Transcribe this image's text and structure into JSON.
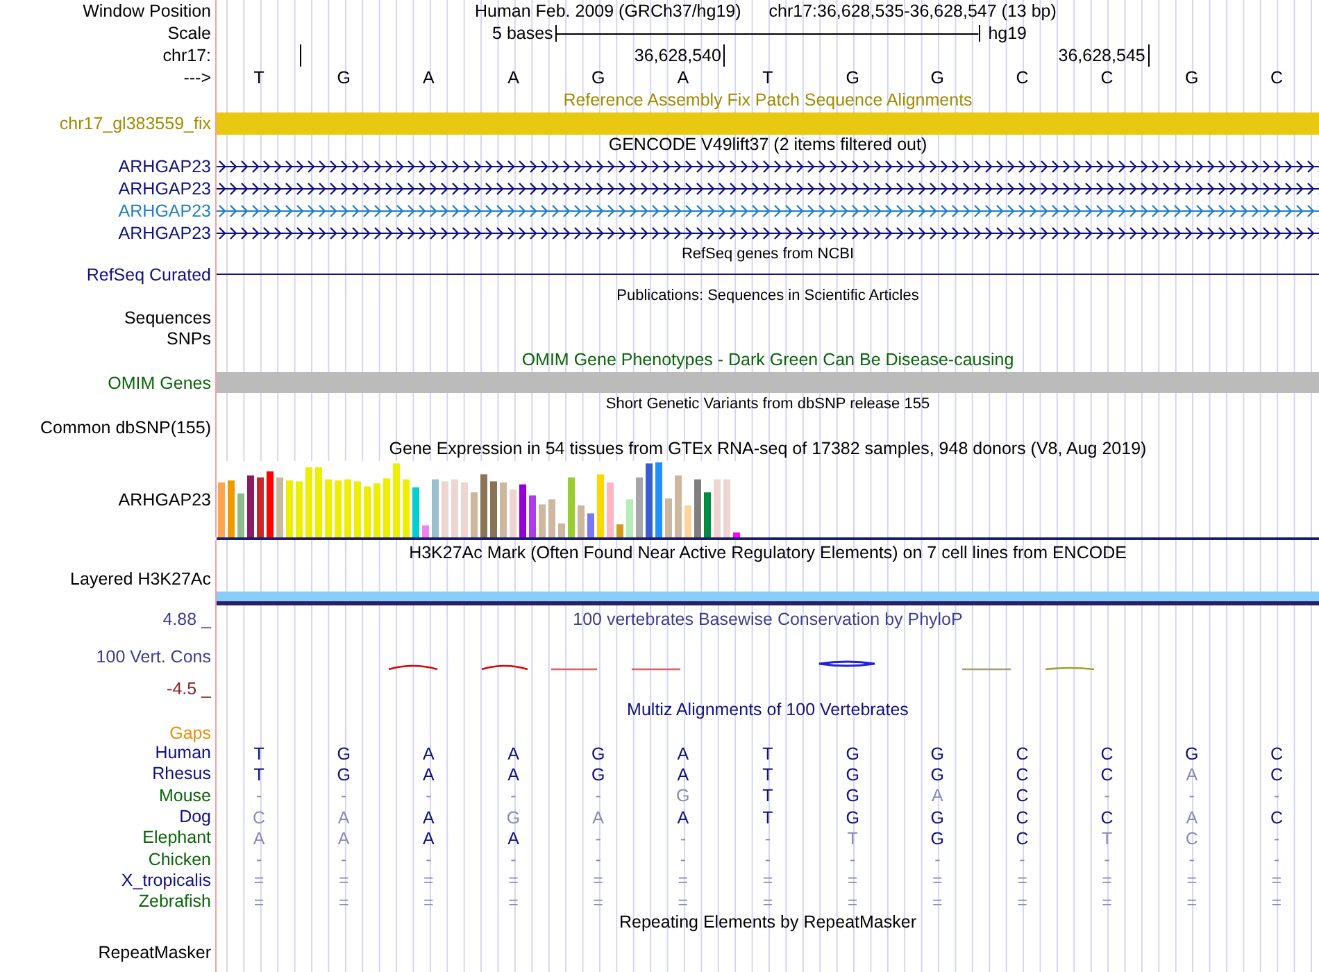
{
  "ruler": {
    "position_label": "Window Position",
    "assembly": "Human Feb. 2009 (GRCh37/hg19)",
    "range": "chr17:36,628,535-36,628,547 (13 bp)",
    "scale_label": "Scale",
    "scale_text": "5 bases",
    "scale_assembly": "hg19",
    "chrom_label": "chr17:",
    "ticks": [
      {
        "kind": "mark"
      },
      {
        "kind": "labeled",
        "label": "36,628,540"
      },
      {
        "kind": "labeled",
        "label": "36,628,545"
      }
    ],
    "strand_label": "--->",
    "bases": [
      "T",
      "G",
      "A",
      "A",
      "G",
      "A",
      "T",
      "G",
      "G",
      "C",
      "C",
      "G",
      "C"
    ]
  },
  "tracks": [
    {
      "kind": "fix_patch",
      "title": "Reference Assembly Fix Patch Sequence Alignments",
      "label": "chr17_gl383559_fix"
    },
    {
      "kind": "genes",
      "title": "GENCODE V49lift37 (2 items filtered out)",
      "genes": [
        {
          "label": "ARHGAP23",
          "color": "#10107e"
        },
        {
          "label": "ARHGAP23",
          "color": "#10107e"
        },
        {
          "label": "ARHGAP23",
          "color": "#1f7fc4"
        },
        {
          "label": "ARHGAP23",
          "color": "#10107e"
        }
      ]
    },
    {
      "kind": "refseq",
      "title": "RefSeq genes from NCBI",
      "label": "RefSeq Curated"
    },
    {
      "kind": "publications",
      "title": "Publications: Sequences in Scientific Articles",
      "labels": [
        "Sequences",
        "SNPs"
      ]
    },
    {
      "kind": "omim",
      "title": "OMIM Gene Phenotypes - Dark Green Can Be Disease-causing",
      "label": "OMIM Genes"
    },
    {
      "kind": "dbsnp",
      "title": "Short Genetic Variants from dbSNP release 155",
      "label": "Common dbSNP(155)"
    },
    {
      "kind": "gtex",
      "title": "Gene Expression in 54 tissues from GTEx RNA-seq of 17382 samples, 948 donors (V8, Aug 2019)",
      "label": "ARHGAP23"
    },
    {
      "kind": "h3k27ac",
      "title": "H3K27Ac Mark (Often Found Near Active Regulatory Elements) on 7 cell lines from ENCODE",
      "label": "Layered H3K27Ac"
    },
    {
      "kind": "phylop",
      "title": "100 vertebrates Basewise Conservation by PhyloP",
      "label": "100 Vert. Cons",
      "max_label": "4.88 _",
      "min_label": "-4.5 _"
    },
    {
      "kind": "multiz",
      "title": "Multiz Alignments of 100 Vertebrates",
      "gaps_label": "Gaps",
      "species": [
        {
          "name": "Human",
          "color": "#10107e",
          "bases": [
            {
              "base": "T",
              "dim": false
            },
            {
              "base": "G",
              "dim": false
            },
            {
              "base": "A",
              "dim": false
            },
            {
              "base": "A",
              "dim": false
            },
            {
              "base": "G",
              "dim": false
            },
            {
              "base": "A",
              "dim": false
            },
            {
              "base": "T",
              "dim": false
            },
            {
              "base": "G",
              "dim": false
            },
            {
              "base": "G",
              "dim": false
            },
            {
              "base": "C",
              "dim": false
            },
            {
              "base": "C",
              "dim": false
            },
            {
              "base": "G",
              "dim": false
            },
            {
              "base": "C",
              "dim": false
            }
          ]
        },
        {
          "name": "Rhesus",
          "color": "#10107e",
          "bases": [
            {
              "base": "T",
              "dim": false
            },
            {
              "base": "G",
              "dim": false
            },
            {
              "base": "A",
              "dim": false
            },
            {
              "base": "A",
              "dim": false
            },
            {
              "base": "G",
              "dim": false
            },
            {
              "base": "A",
              "dim": false
            },
            {
              "base": "T",
              "dim": false
            },
            {
              "base": "G",
              "dim": false
            },
            {
              "base": "G",
              "dim": false
            },
            {
              "base": "C",
              "dim": false
            },
            {
              "base": "C",
              "dim": false
            },
            {
              "base": "A",
              "dim": true
            },
            {
              "base": "C",
              "dim": false
            }
          ]
        },
        {
          "name": "Mouse",
          "color": "#0a640a",
          "bases": [
            {
              "base": "-",
              "dim": true
            },
            {
              "base": "-",
              "dim": true
            },
            {
              "base": "-",
              "dim": true
            },
            {
              "base": "-",
              "dim": true
            },
            {
              "base": "-",
              "dim": true
            },
            {
              "base": "G",
              "dim": true
            },
            {
              "base": "T",
              "dim": false
            },
            {
              "base": "G",
              "dim": false
            },
            {
              "base": "A",
              "dim": true
            },
            {
              "base": "C",
              "dim": false
            },
            {
              "base": "-",
              "dim": true
            },
            {
              "base": "-",
              "dim": true
            },
            {
              "base": "-",
              "dim": true
            }
          ]
        },
        {
          "name": "Dog",
          "color": "#10107e",
          "bases": [
            {
              "base": "C",
              "dim": true
            },
            {
              "base": "A",
              "dim": true
            },
            {
              "base": "A",
              "dim": false
            },
            {
              "base": "G",
              "dim": true
            },
            {
              "base": "A",
              "dim": true
            },
            {
              "base": "A",
              "dim": false
            },
            {
              "base": "T",
              "dim": false
            },
            {
              "base": "G",
              "dim": false
            },
            {
              "base": "G",
              "dim": false
            },
            {
              "base": "C",
              "dim": false
            },
            {
              "base": "C",
              "dim": false
            },
            {
              "base": "A",
              "dim": true
            },
            {
              "base": "C",
              "dim": false
            }
          ]
        },
        {
          "name": "Elephant",
          "color": "#0a640a",
          "bases": [
            {
              "base": "A",
              "dim": true
            },
            {
              "base": "A",
              "dim": true
            },
            {
              "base": "A",
              "dim": false
            },
            {
              "base": "A",
              "dim": false
            },
            {
              "base": "-",
              "dim": true
            },
            {
              "base": "-",
              "dim": true
            },
            {
              "base": "-",
              "dim": true
            },
            {
              "base": "T",
              "dim": true
            },
            {
              "base": "G",
              "dim": false
            },
            {
              "base": "C",
              "dim": false
            },
            {
              "base": "T",
              "dim": true
            },
            {
              "base": "C",
              "dim": true
            },
            {
              "base": "-",
              "dim": true
            }
          ]
        },
        {
          "name": "Chicken",
          "color": "#0a640a",
          "bases": [
            {
              "base": "-",
              "dim": true
            },
            {
              "base": "-",
              "dim": true
            },
            {
              "base": "-",
              "dim": true
            },
            {
              "base": "-",
              "dim": true
            },
            {
              "base": "-",
              "dim": true
            },
            {
              "base": "-",
              "dim": true
            },
            {
              "base": "-",
              "dim": true
            },
            {
              "base": "-",
              "dim": true
            },
            {
              "base": "-",
              "dim": true
            },
            {
              "base": "-",
              "dim": true
            },
            {
              "base": "-",
              "dim": true
            },
            {
              "base": "-",
              "dim": true
            },
            {
              "base": "-",
              "dim": true
            }
          ]
        },
        {
          "name": "X_tropicalis",
          "color": "#10107e",
          "bases": [
            {
              "base": "=",
              "dim": true
            },
            {
              "base": "=",
              "dim": true
            },
            {
              "base": "=",
              "dim": true
            },
            {
              "base": "=",
              "dim": true
            },
            {
              "base": "=",
              "dim": true
            },
            {
              "base": "=",
              "dim": true
            },
            {
              "base": "=",
              "dim": true
            },
            {
              "base": "=",
              "dim": true
            },
            {
              "base": "=",
              "dim": true
            },
            {
              "base": "=",
              "dim": true
            },
            {
              "base": "=",
              "dim": true
            },
            {
              "base": "=",
              "dim": true
            },
            {
              "base": "=",
              "dim": true
            }
          ]
        },
        {
          "name": "Zebrafish",
          "color": "#0a640a",
          "bases": [
            {
              "base": "=",
              "dim": true
            },
            {
              "base": "=",
              "dim": true
            },
            {
              "base": "=",
              "dim": true
            },
            {
              "base": "=",
              "dim": true
            },
            {
              "base": "=",
              "dim": true
            },
            {
              "base": "=",
              "dim": true
            },
            {
              "base": "=",
              "dim": true
            },
            {
              "base": "=",
              "dim": true
            },
            {
              "base": "=",
              "dim": true
            },
            {
              "base": "=",
              "dim": true
            },
            {
              "base": "=",
              "dim": true
            },
            {
              "base": "=",
              "dim": true
            },
            {
              "base": "=",
              "dim": true
            }
          ]
        }
      ]
    },
    {
      "kind": "repeatmasker",
      "title": "Repeating Elements by RepeatMasker",
      "label": "RepeatMasker"
    }
  ]
}
